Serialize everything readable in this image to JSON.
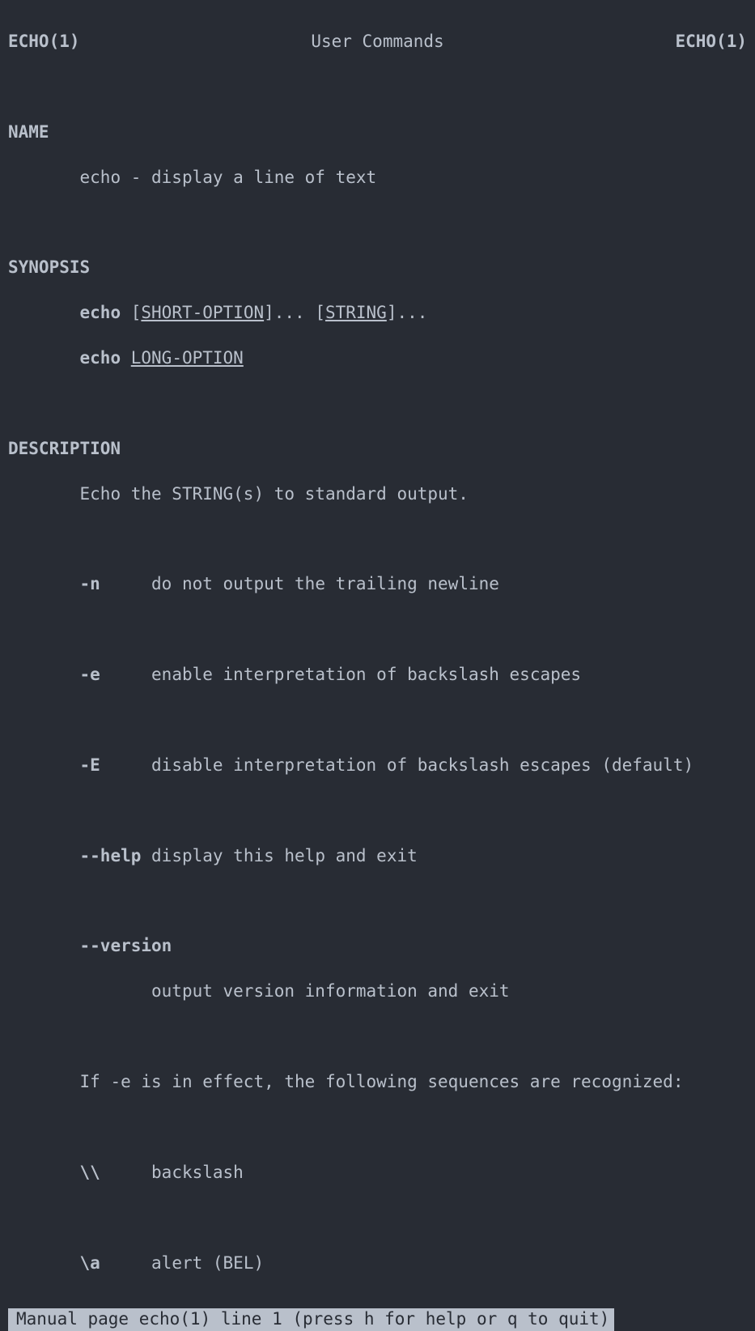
{
  "header": {
    "left": "ECHO(1)",
    "center": "User Commands",
    "right": "ECHO(1)"
  },
  "sections": {
    "name": {
      "title": "NAME",
      "content": "echo - display a line of text"
    },
    "synopsis": {
      "title": "SYNOPSIS",
      "line1": {
        "cmd": "echo",
        "bracket1": " [",
        "opt1": "SHORT-OPTION",
        "mid": "]... [",
        "opt2": "STRING",
        "end": "]..."
      },
      "line2": {
        "cmd": "echo",
        "space": " ",
        "opt": "LONG-OPTION"
      }
    },
    "description": {
      "title": "DESCRIPTION",
      "intro": "Echo the STRING(s) to standard output.",
      "options": [
        {
          "flag": "-n",
          "desc": "do not output the trailing newline"
        },
        {
          "flag": "-e",
          "desc": "enable interpretation of backslash escapes"
        },
        {
          "flag": "-E",
          "desc": "disable interpretation of backslash escapes (default)"
        },
        {
          "flag": "--help",
          "desc": "display this help and exit"
        }
      ],
      "version": {
        "flag": "--version",
        "desc": "output version information and exit"
      },
      "escape_intro": "If -e is in effect, the following sequences are recognized:",
      "escapes": [
        {
          "seq": "\\\\",
          "desc": "backslash"
        },
        {
          "seq": "\\a",
          "desc": "alert (BEL)"
        }
      ]
    }
  },
  "status": "Manual page echo(1) line 1 (press h for help or q to quit)"
}
